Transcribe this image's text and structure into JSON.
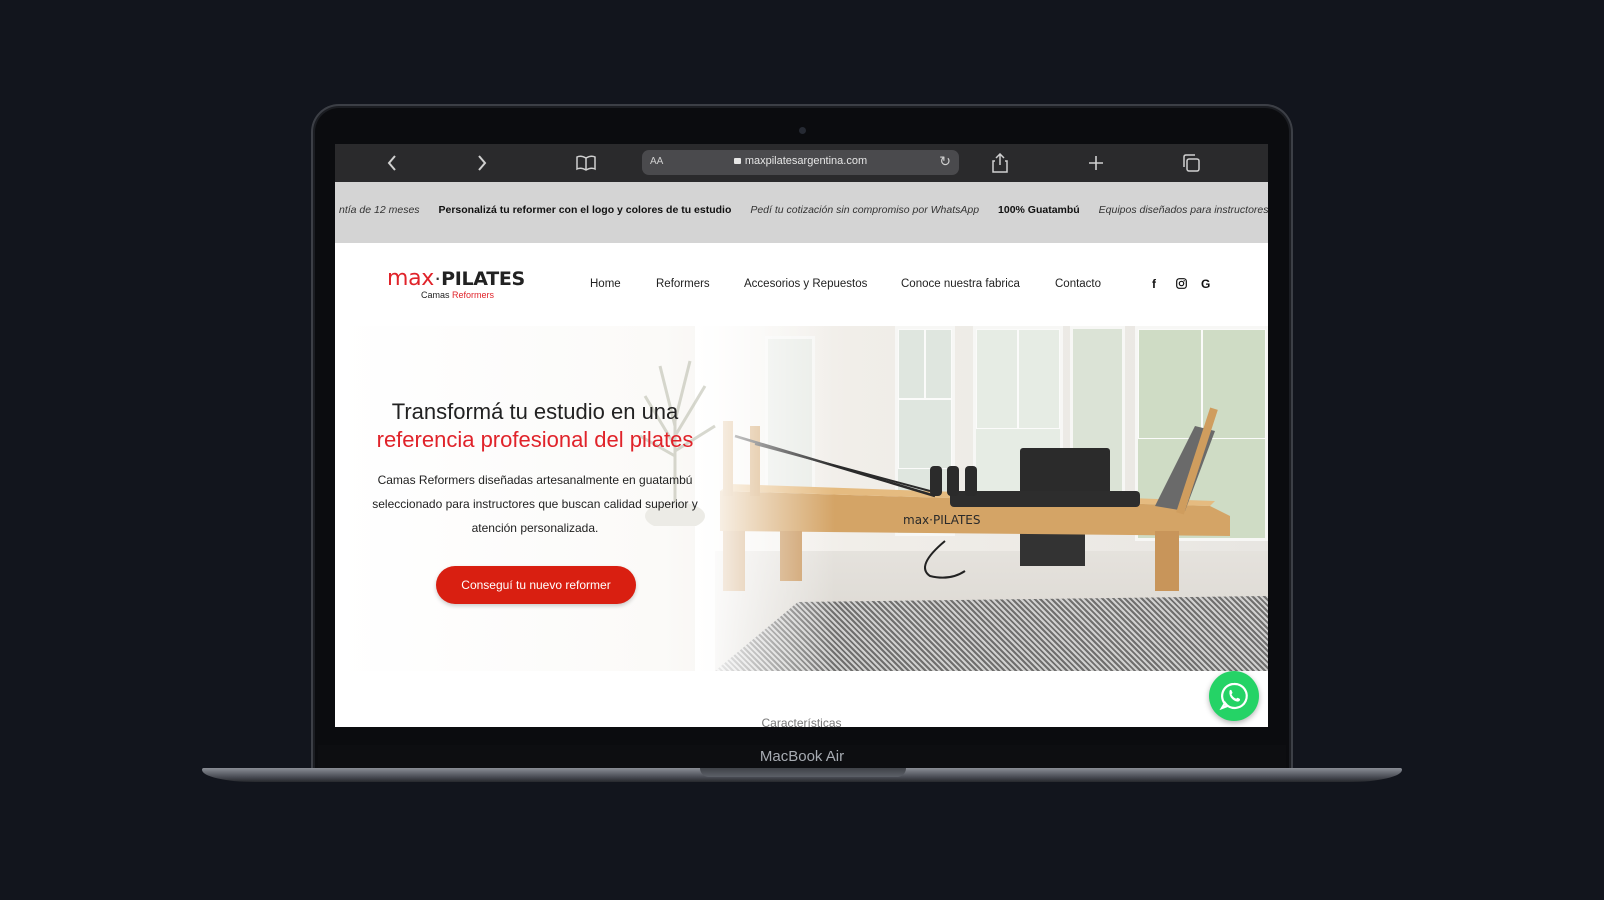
{
  "device": {
    "model_label": "MacBook Air"
  },
  "browser": {
    "url": "maxpilatesargentina.com",
    "text_size_label": "AA",
    "icons": [
      "back-icon",
      "forward-icon",
      "bookmarks-icon",
      "lock-icon",
      "reload-icon",
      "share-icon",
      "new-tab-icon",
      "tabs-icon"
    ]
  },
  "announcement": {
    "messages": [
      {
        "text": "ntía de 12 meses",
        "style": "italic"
      },
      {
        "text": "Personalizá tu reformer con el logo y colores de tu estudio",
        "style": "bold"
      },
      {
        "text": "Pedí tu cotización sin compromiso por WhatsApp",
        "style": "italic"
      },
      {
        "text": "100% Guatambú",
        "style": "bold"
      },
      {
        "text": "Equipos diseñados para instructores",
        "style": "italic"
      }
    ]
  },
  "header": {
    "logo": {
      "brand_red": "max",
      "separator": "·",
      "brand_dark": "PILATES",
      "tagline_dark": "Camas",
      "tagline_red": "Reformers"
    },
    "nav": [
      "Home",
      "Reformers",
      "Accesorios y Repuestos",
      "Conoce nuestra fabrica",
      "Contacto"
    ],
    "social_icons": [
      "facebook-icon",
      "instagram-icon",
      "google-icon"
    ]
  },
  "hero": {
    "title_line1": "Transformá tu estudio en una",
    "title_line2": "referencia profesional del pilates",
    "lead_line1": "Camas Reformers diseñadas artesanalmente en guatambú",
    "lead_line2": "seleccionado para instructores que buscan calidad superior y",
    "lead_line3": "atención personalizada.",
    "cta": "Conseguí tu nuevo reformer",
    "product_brand": "max·PILATES"
  },
  "next_section": {
    "title": "Características"
  },
  "colors": {
    "brand_red": "#e0232a",
    "cta_red": "#d91f11",
    "whatsapp_green": "#25d366",
    "page_bg": "#12151d"
  }
}
